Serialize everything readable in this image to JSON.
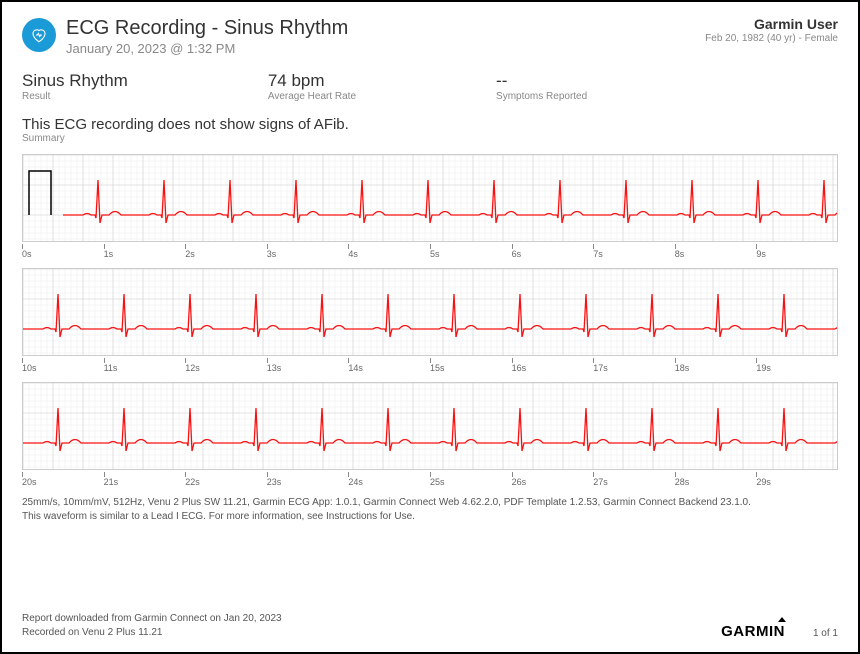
{
  "header": {
    "title": "ECG Recording - Sinus Rhythm",
    "datetime": "January 20, 2023 @ 1:32 PM",
    "user_name": "Garmin User",
    "user_meta": "Feb 20, 1982 (40 yr) - Female"
  },
  "stats": {
    "result_value": "Sinus Rhythm",
    "result_label": "Result",
    "hr_value": "74 bpm",
    "hr_label": "Average Heart Rate",
    "symptoms_value": "--",
    "symptoms_label": "Symptoms Reported"
  },
  "summary": {
    "text": "This ECG recording does not show signs of AFib.",
    "label": "Summary"
  },
  "strips": {
    "calibration": {
      "speed_mm_s": 25,
      "gain_mm_mV": 10,
      "sample_hz": 512
    },
    "heart_rate_bpm": 74,
    "ticks": [
      [
        "0s",
        "1s",
        "2s",
        "3s",
        "4s",
        "5s",
        "6s",
        "7s",
        "8s",
        "9s"
      ],
      [
        "10s",
        "11s",
        "12s",
        "13s",
        "14s",
        "15s",
        "16s",
        "17s",
        "18s",
        "19s"
      ],
      [
        "20s",
        "21s",
        "22s",
        "23s",
        "24s",
        "25s",
        "26s",
        "27s",
        "28s",
        "29s"
      ]
    ]
  },
  "footnote": {
    "line1": "25mm/s, 10mm/mV, 512Hz, Venu 2 Plus SW 11.21, Garmin ECG App: 1.0.1, Garmin Connect Web 4.62.2.0, PDF Template 1.2.53, Garmin Connect Backend 23.1.0.",
    "line2": "This waveform is similar to a Lead I ECG. For more information, see Instructions for Use."
  },
  "footer": {
    "downloaded": "Report downloaded from Garmin Connect on Jan 20, 2023",
    "recorded": "Recorded on Venu 2 Plus 11.21",
    "brand": "GARMIN",
    "page": "1 of 1"
  }
}
